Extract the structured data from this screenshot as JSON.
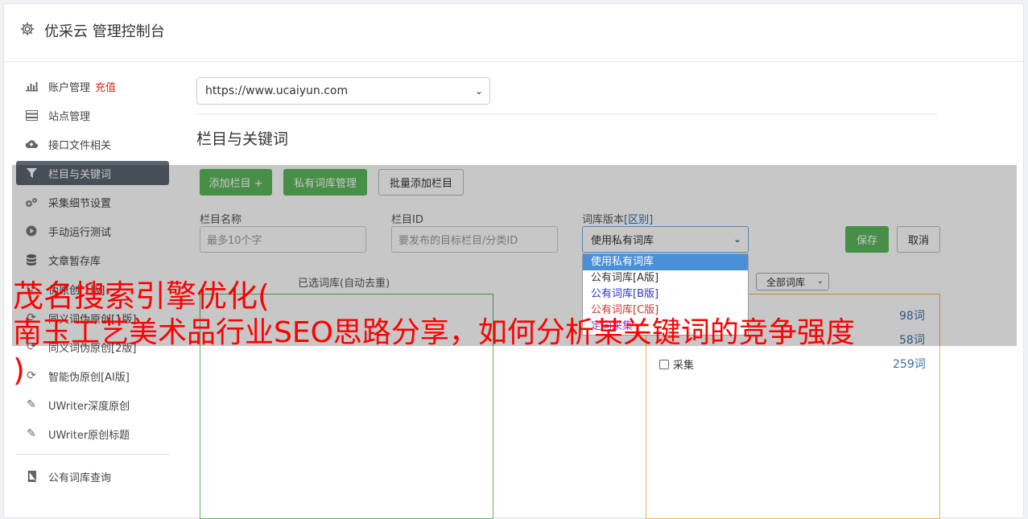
{
  "header": {
    "title": "优采云 管理控制台",
    "icon": "gear-icon"
  },
  "sidebar": {
    "items": [
      {
        "label": "账户管理",
        "icon": "bar-chart-icon"
      },
      {
        "label": "站点管理",
        "icon": "server-icon"
      },
      {
        "label": "接口文件相关",
        "icon": "cloud-upload-icon"
      },
      {
        "label": "栏目与关键词",
        "icon": "filter-icon"
      },
      {
        "label": "采集细节设置",
        "icon": "cogs-icon"
      },
      {
        "label": "手动运行测试",
        "icon": "play-circle-icon"
      },
      {
        "label": "文章暂存库",
        "icon": "database-icon"
      },
      {
        "label": "伪原创[1版]",
        "icon": "refresh-icon"
      },
      {
        "label": "同义词伪原创[1版]",
        "icon": "refresh-icon"
      },
      {
        "label": "同义词伪原创[2版]",
        "icon": "refresh-icon"
      },
      {
        "label": "智能伪原创[AI版]",
        "icon": "refresh-icon"
      },
      {
        "label": "UWriter深度原创",
        "icon": "edit-icon"
      },
      {
        "label": "UWriter原创标题",
        "icon": "edit-icon"
      },
      {
        "label": "公有词库查询",
        "icon": "book-icon"
      }
    ],
    "recharge_label": "充值"
  },
  "main": {
    "site_select_value": "https://www.ucaiyun.com",
    "section_title": "栏目与关键词",
    "buttons": {
      "add_column": "添加栏目 +",
      "private_lib": "私有词库管理",
      "batch_add": "批量添加栏目",
      "save": "保存",
      "cancel": "取消"
    },
    "fields": {
      "column_name_label": "栏目名称",
      "column_name_placeholder": "最多10个字",
      "column_id_label": "栏目ID",
      "column_id_placeholder": "要发布的目标栏目/分类ID",
      "lib_version_label": "词库版本",
      "lib_version_link": "[区别]",
      "lib_version_value": "使用私有词库"
    },
    "dropdown_options": [
      {
        "label": "使用私有词库",
        "color": "#ffffff"
      },
      {
        "label": "公有词库[A版]",
        "color": "#333333"
      },
      {
        "label": "公有词库[B版]",
        "color": "#3333cc"
      },
      {
        "label": "公有词库[C版]",
        "color": "#cc3333"
      },
      {
        "label": "定向采集",
        "color": "#9933cc"
      }
    ],
    "selected_lib_label": "已选词库(自动去重)",
    "all_lib_select": "全部词库",
    "right_list": {
      "count1": "98词",
      "count2": "58词",
      "count3": "259词",
      "check_label": "采集"
    }
  },
  "watermark": {
    "line1": "茂名搜索引擎优化(",
    "line2": "南玉工艺美术品行业SEO思路分享，如何分析某关键词的竞争强度",
    "line3": ")"
  },
  "colors": {
    "accent_green": "#5cb85c",
    "active_nav": "#5b6471",
    "watermark": "#ff0000"
  }
}
